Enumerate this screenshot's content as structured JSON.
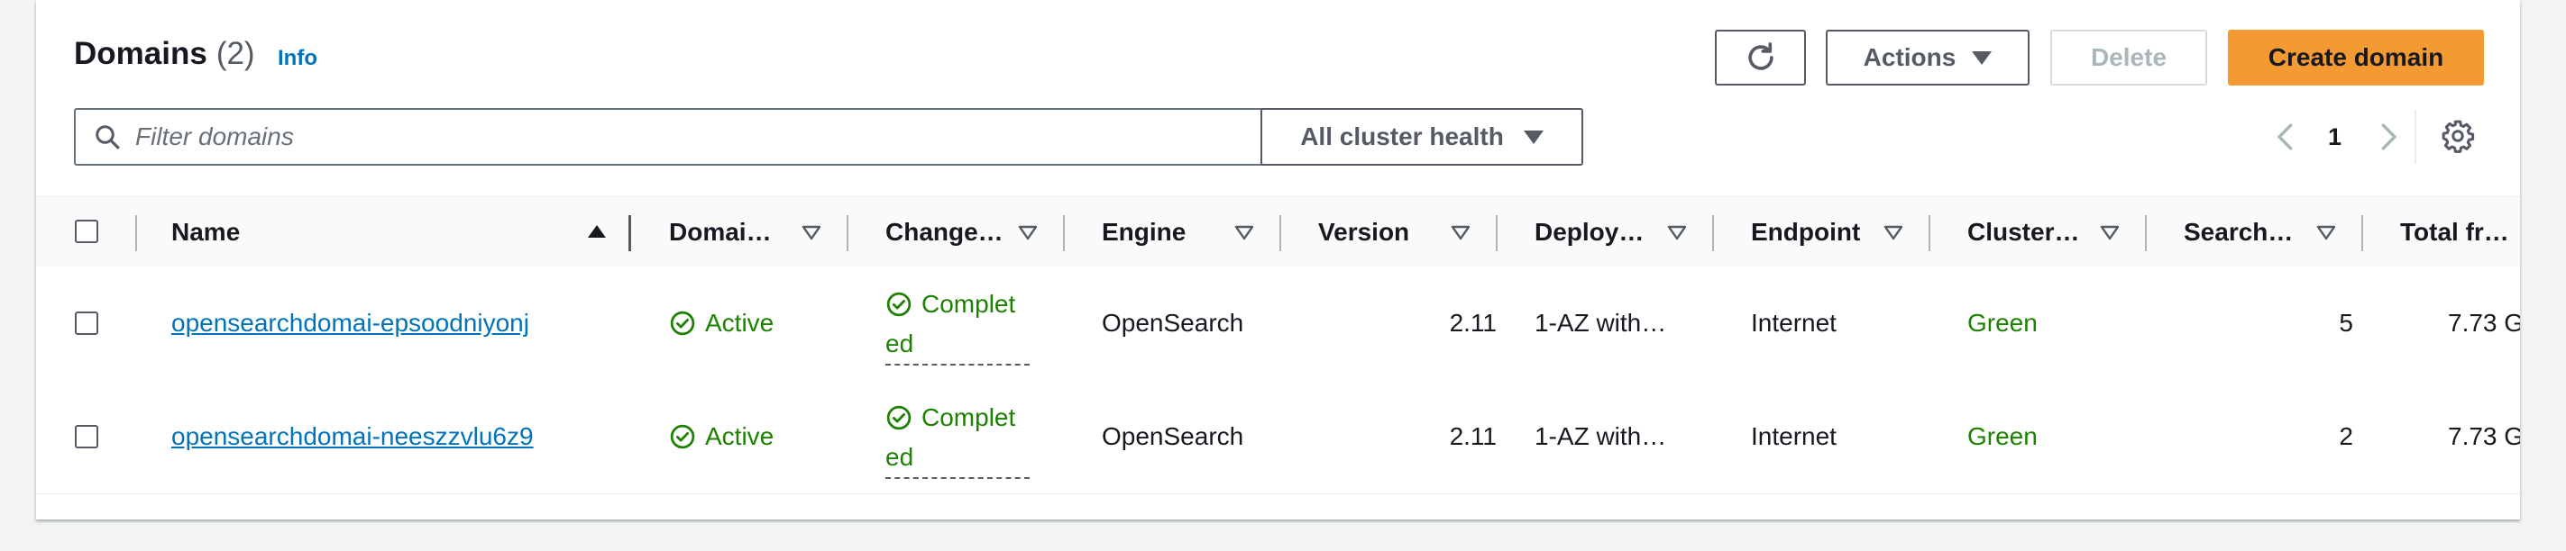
{
  "header": {
    "title": "Domains",
    "count": "(2)",
    "info": "Info"
  },
  "toolbar": {
    "actions_label": "Actions",
    "delete_label": "Delete",
    "create_label": "Create domain"
  },
  "filter": {
    "placeholder": "Filter domains",
    "value": ""
  },
  "health_select": {
    "label": "All cluster health"
  },
  "pagination": {
    "page": "1"
  },
  "columns": [
    "Name",
    "Domai…",
    "Change…",
    "Engine",
    "Version",
    "Deploy…",
    "Endpoint",
    "Cluster…",
    "Search…",
    "Total fr…"
  ],
  "rows": [
    {
      "name": "opensearchdomai-epsoodniyonj",
      "domain_status": "Active",
      "change_status_1": "Complet",
      "change_status_2": "ed",
      "engine": "OpenSearch",
      "version": "2.11",
      "deployment": "1-AZ with…",
      "endpoint": "Internet",
      "cluster_health": "Green",
      "search_instances": "5",
      "total_free": "7.73 G"
    },
    {
      "name": "opensearchdomai-neeszzvlu6z9",
      "domain_status": "Active",
      "change_status_1": "Complet",
      "change_status_2": "ed",
      "engine": "OpenSearch",
      "version": "2.11",
      "deployment": "1-AZ with…",
      "endpoint": "Internet",
      "cluster_health": "Green",
      "search_instances": "2",
      "total_free": "7.73 G"
    }
  ],
  "colors": {
    "link": "#0073bb",
    "success": "#1d8102",
    "primary": "#f39a33"
  },
  "icons": [
    "refresh-icon",
    "search-icon",
    "caret-down-icon",
    "chevron-left-icon",
    "chevron-right-icon",
    "settings-icon",
    "sort-ascending-icon",
    "sort-icon",
    "check-circle-icon"
  ]
}
